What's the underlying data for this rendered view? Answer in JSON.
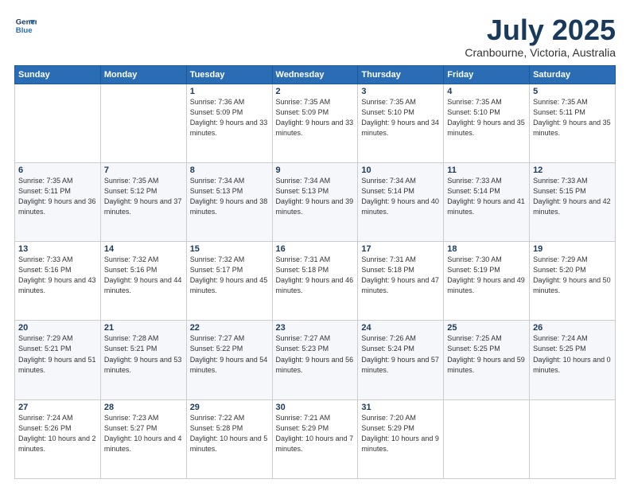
{
  "header": {
    "logo_line1": "General",
    "logo_line2": "Blue",
    "month": "July 2025",
    "location": "Cranbourne, Victoria, Australia"
  },
  "weekdays": [
    "Sunday",
    "Monday",
    "Tuesday",
    "Wednesday",
    "Thursday",
    "Friday",
    "Saturday"
  ],
  "weeks": [
    [
      {
        "day": "",
        "info": ""
      },
      {
        "day": "",
        "info": ""
      },
      {
        "day": "1",
        "info": "Sunrise: 7:36 AM\nSunset: 5:09 PM\nDaylight: 9 hours\nand 33 minutes."
      },
      {
        "day": "2",
        "info": "Sunrise: 7:35 AM\nSunset: 5:09 PM\nDaylight: 9 hours\nand 33 minutes."
      },
      {
        "day": "3",
        "info": "Sunrise: 7:35 AM\nSunset: 5:10 PM\nDaylight: 9 hours\nand 34 minutes."
      },
      {
        "day": "4",
        "info": "Sunrise: 7:35 AM\nSunset: 5:10 PM\nDaylight: 9 hours\nand 35 minutes."
      },
      {
        "day": "5",
        "info": "Sunrise: 7:35 AM\nSunset: 5:11 PM\nDaylight: 9 hours\nand 35 minutes."
      }
    ],
    [
      {
        "day": "6",
        "info": "Sunrise: 7:35 AM\nSunset: 5:11 PM\nDaylight: 9 hours\nand 36 minutes."
      },
      {
        "day": "7",
        "info": "Sunrise: 7:35 AM\nSunset: 5:12 PM\nDaylight: 9 hours\nand 37 minutes."
      },
      {
        "day": "8",
        "info": "Sunrise: 7:34 AM\nSunset: 5:13 PM\nDaylight: 9 hours\nand 38 minutes."
      },
      {
        "day": "9",
        "info": "Sunrise: 7:34 AM\nSunset: 5:13 PM\nDaylight: 9 hours\nand 39 minutes."
      },
      {
        "day": "10",
        "info": "Sunrise: 7:34 AM\nSunset: 5:14 PM\nDaylight: 9 hours\nand 40 minutes."
      },
      {
        "day": "11",
        "info": "Sunrise: 7:33 AM\nSunset: 5:14 PM\nDaylight: 9 hours\nand 41 minutes."
      },
      {
        "day": "12",
        "info": "Sunrise: 7:33 AM\nSunset: 5:15 PM\nDaylight: 9 hours\nand 42 minutes."
      }
    ],
    [
      {
        "day": "13",
        "info": "Sunrise: 7:33 AM\nSunset: 5:16 PM\nDaylight: 9 hours\nand 43 minutes."
      },
      {
        "day": "14",
        "info": "Sunrise: 7:32 AM\nSunset: 5:16 PM\nDaylight: 9 hours\nand 44 minutes."
      },
      {
        "day": "15",
        "info": "Sunrise: 7:32 AM\nSunset: 5:17 PM\nDaylight: 9 hours\nand 45 minutes."
      },
      {
        "day": "16",
        "info": "Sunrise: 7:31 AM\nSunset: 5:18 PM\nDaylight: 9 hours\nand 46 minutes."
      },
      {
        "day": "17",
        "info": "Sunrise: 7:31 AM\nSunset: 5:18 PM\nDaylight: 9 hours\nand 47 minutes."
      },
      {
        "day": "18",
        "info": "Sunrise: 7:30 AM\nSunset: 5:19 PM\nDaylight: 9 hours\nand 49 minutes."
      },
      {
        "day": "19",
        "info": "Sunrise: 7:29 AM\nSunset: 5:20 PM\nDaylight: 9 hours\nand 50 minutes."
      }
    ],
    [
      {
        "day": "20",
        "info": "Sunrise: 7:29 AM\nSunset: 5:21 PM\nDaylight: 9 hours\nand 51 minutes."
      },
      {
        "day": "21",
        "info": "Sunrise: 7:28 AM\nSunset: 5:21 PM\nDaylight: 9 hours\nand 53 minutes."
      },
      {
        "day": "22",
        "info": "Sunrise: 7:27 AM\nSunset: 5:22 PM\nDaylight: 9 hours\nand 54 minutes."
      },
      {
        "day": "23",
        "info": "Sunrise: 7:27 AM\nSunset: 5:23 PM\nDaylight: 9 hours\nand 56 minutes."
      },
      {
        "day": "24",
        "info": "Sunrise: 7:26 AM\nSunset: 5:24 PM\nDaylight: 9 hours\nand 57 minutes."
      },
      {
        "day": "25",
        "info": "Sunrise: 7:25 AM\nSunset: 5:25 PM\nDaylight: 9 hours\nand 59 minutes."
      },
      {
        "day": "26",
        "info": "Sunrise: 7:24 AM\nSunset: 5:25 PM\nDaylight: 10 hours\nand 0 minutes."
      }
    ],
    [
      {
        "day": "27",
        "info": "Sunrise: 7:24 AM\nSunset: 5:26 PM\nDaylight: 10 hours\nand 2 minutes."
      },
      {
        "day": "28",
        "info": "Sunrise: 7:23 AM\nSunset: 5:27 PM\nDaylight: 10 hours\nand 4 minutes."
      },
      {
        "day": "29",
        "info": "Sunrise: 7:22 AM\nSunset: 5:28 PM\nDaylight: 10 hours\nand 5 minutes."
      },
      {
        "day": "30",
        "info": "Sunrise: 7:21 AM\nSunset: 5:29 PM\nDaylight: 10 hours\nand 7 minutes."
      },
      {
        "day": "31",
        "info": "Sunrise: 7:20 AM\nSunset: 5:29 PM\nDaylight: 10 hours\nand 9 minutes."
      },
      {
        "day": "",
        "info": ""
      },
      {
        "day": "",
        "info": ""
      }
    ]
  ]
}
